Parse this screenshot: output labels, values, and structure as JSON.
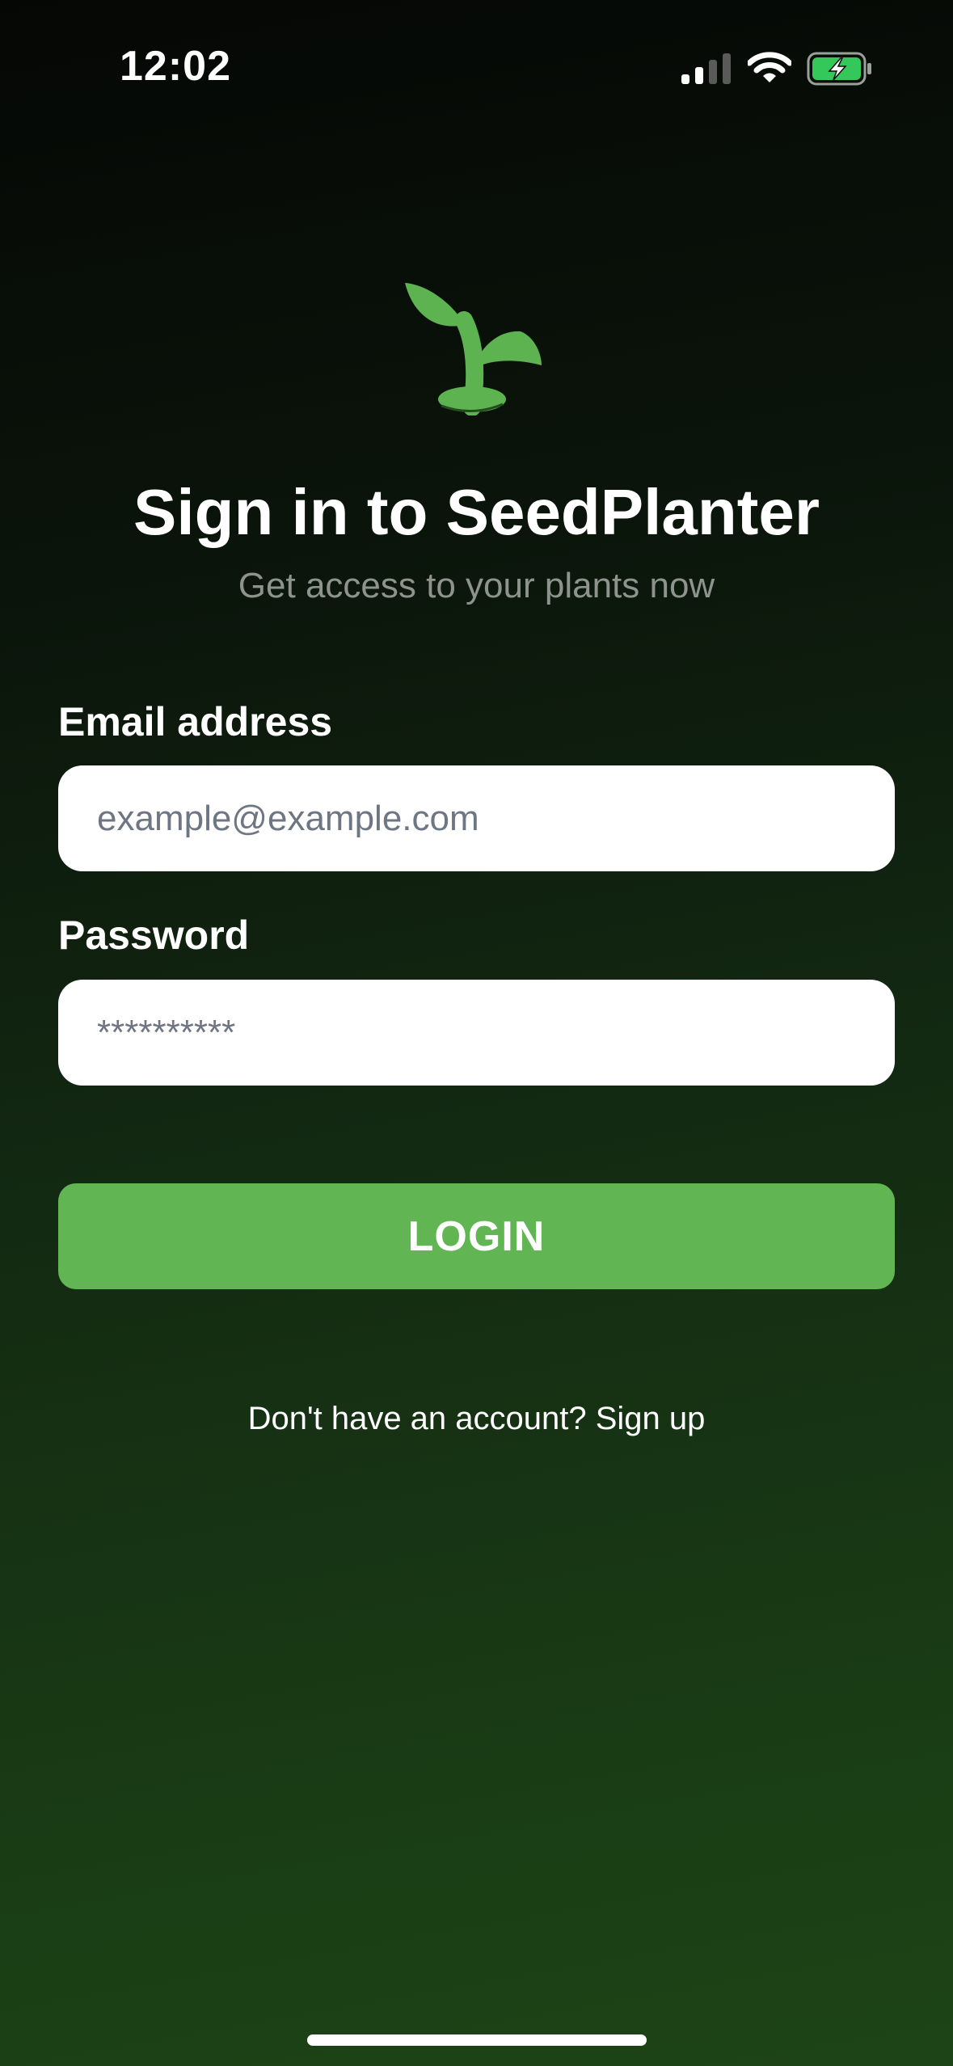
{
  "status_bar": {
    "time": "12:02",
    "icons": [
      "cellular-signal-icon",
      "wifi-icon",
      "battery-charging-icon"
    ]
  },
  "logo": {
    "icon": "sprout-icon",
    "color": "#5cb350"
  },
  "header": {
    "title": "Sign in to SeedPlanter",
    "subtitle": "Get access to your plants now"
  },
  "form": {
    "email": {
      "label": "Email address",
      "value": "",
      "placeholder": "example@example.com"
    },
    "password": {
      "label": "Password",
      "value": "",
      "placeholder": "**********"
    },
    "submit_label": "LOGIN"
  },
  "footer": {
    "prompt": "Don't have an account? ",
    "link": "Sign up"
  },
  "colors": {
    "accent": "#62b553",
    "background_top": "#050705",
    "background_bottom": "#1d4416",
    "subtitle": "#8e938e",
    "placeholder": "#6f7683"
  }
}
